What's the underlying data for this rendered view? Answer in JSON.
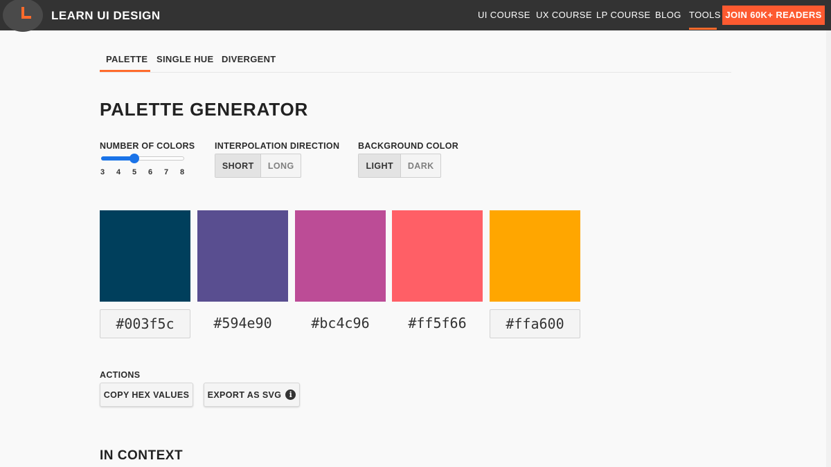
{
  "header": {
    "brand": "LEARN UI DESIGN",
    "nav": [
      "UI COURSE",
      "UX COURSE",
      "LP COURSE",
      "BLOG",
      "TOOLS"
    ],
    "active_nav": "TOOLS",
    "cta": "JOIN 60K+ READERS",
    "accent_color": "#ff6b2c"
  },
  "tabs": [
    "PALETTE",
    "SINGLE HUE",
    "DIVERGENT"
  ],
  "active_tab": "PALETTE",
  "title": "PALETTE GENERATOR",
  "controls": {
    "number_of_colors": {
      "label": "NUMBER OF COLORS",
      "options": [
        "3",
        "4",
        "5",
        "6",
        "7",
        "8"
      ],
      "value": 5
    },
    "interpolation": {
      "label": "INTERPOLATION DIRECTION",
      "options": [
        "SHORT",
        "LONG"
      ],
      "selected": "SHORT"
    },
    "background": {
      "label": "BACKGROUND COLOR",
      "options": [
        "LIGHT",
        "DARK"
      ],
      "selected": "LIGHT"
    }
  },
  "palette": [
    {
      "hex": "#003f5c",
      "color": "#003f5c",
      "boxed": true
    },
    {
      "hex": "#594e90",
      "color": "#594e90",
      "boxed": false
    },
    {
      "hex": "#bc4c96",
      "color": "#bc4c96",
      "boxed": false
    },
    {
      "hex": "#ff5f66",
      "color": "#ff5f66",
      "boxed": false
    },
    {
      "hex": "#ffa600",
      "color": "#ffa600",
      "boxed": true
    }
  ],
  "actions": {
    "label": "ACTIONS",
    "copy": "COPY HEX VALUES",
    "export": "EXPORT AS SVG",
    "export_icon": "info-icon"
  },
  "in_context": "IN CONTEXT"
}
